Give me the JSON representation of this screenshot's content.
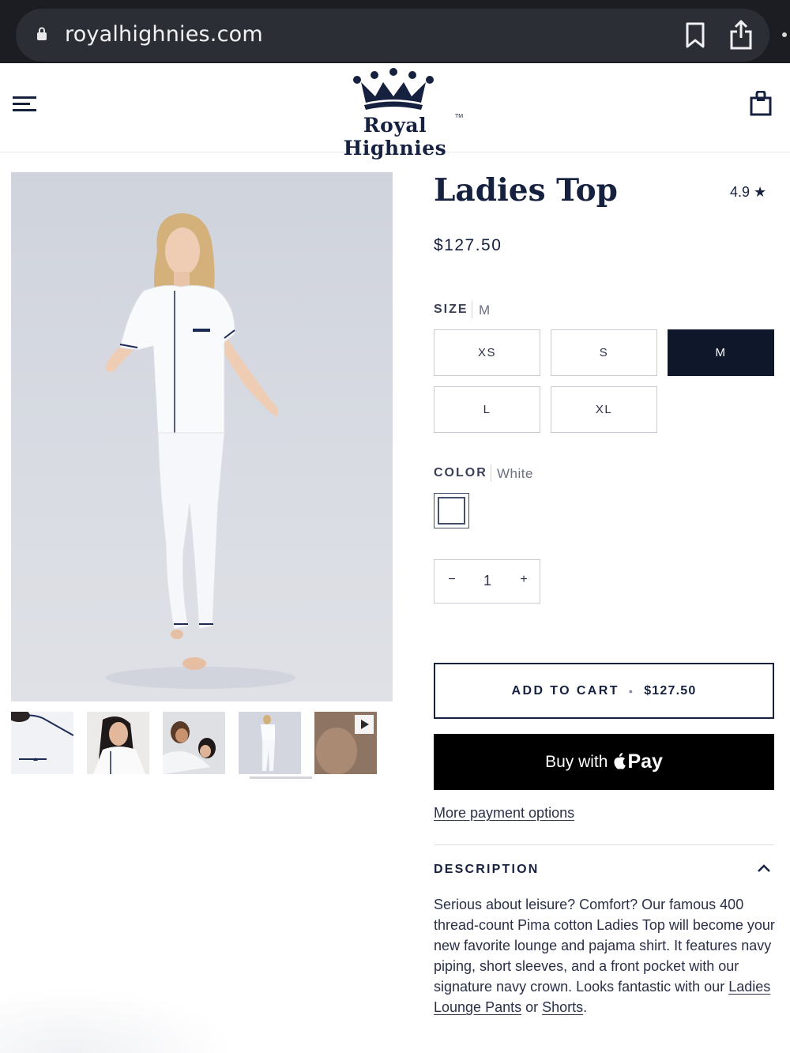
{
  "browser": {
    "url": "royalhighnies.com"
  },
  "header": {
    "logo_text": "Royal Highnies",
    "logo_tm": "TM"
  },
  "gallery": {
    "thumbnails": [
      {
        "name": "pocket-closeup"
      },
      {
        "name": "model-smiling"
      },
      {
        "name": "couple-lounging"
      },
      {
        "name": "full-length",
        "active": true
      },
      {
        "name": "video",
        "has_play": true
      }
    ]
  },
  "product": {
    "title": "Ladies Top",
    "rating": "4.9 ★",
    "price": "$127.50"
  },
  "size": {
    "label": "SIZE",
    "selected": "M",
    "options": [
      "XS",
      "S",
      "M",
      "L",
      "XL"
    ]
  },
  "color": {
    "label": "COLOR",
    "selected": "White"
  },
  "quantity": {
    "minus": "−",
    "value": "1",
    "plus": "+"
  },
  "actions": {
    "add_to_cart": "ADD TO CART",
    "separator": "•",
    "add_to_cart_price": "$127.50",
    "apple_pay_prefix": "Buy with",
    "apple_pay_word": "Pay",
    "more_payment": "More payment options"
  },
  "description": {
    "heading": "DESCRIPTION",
    "text": "Serious about leisure? Comfort? Our famous 400 thread-count Pima cotton Ladies Top will become your new favorite lounge and pajama shirt. It features navy piping, short sleeves, and a front pocket with our signature navy crown. Looks fantastic with our ",
    "link1": "Ladies Lounge Pants",
    "mid": " or ",
    "link2": "Shorts",
    "end": "."
  },
  "colors": {
    "navy": "#15213f",
    "selected_bg": "#0f172b",
    "browser_bg": "#1c1d22"
  }
}
